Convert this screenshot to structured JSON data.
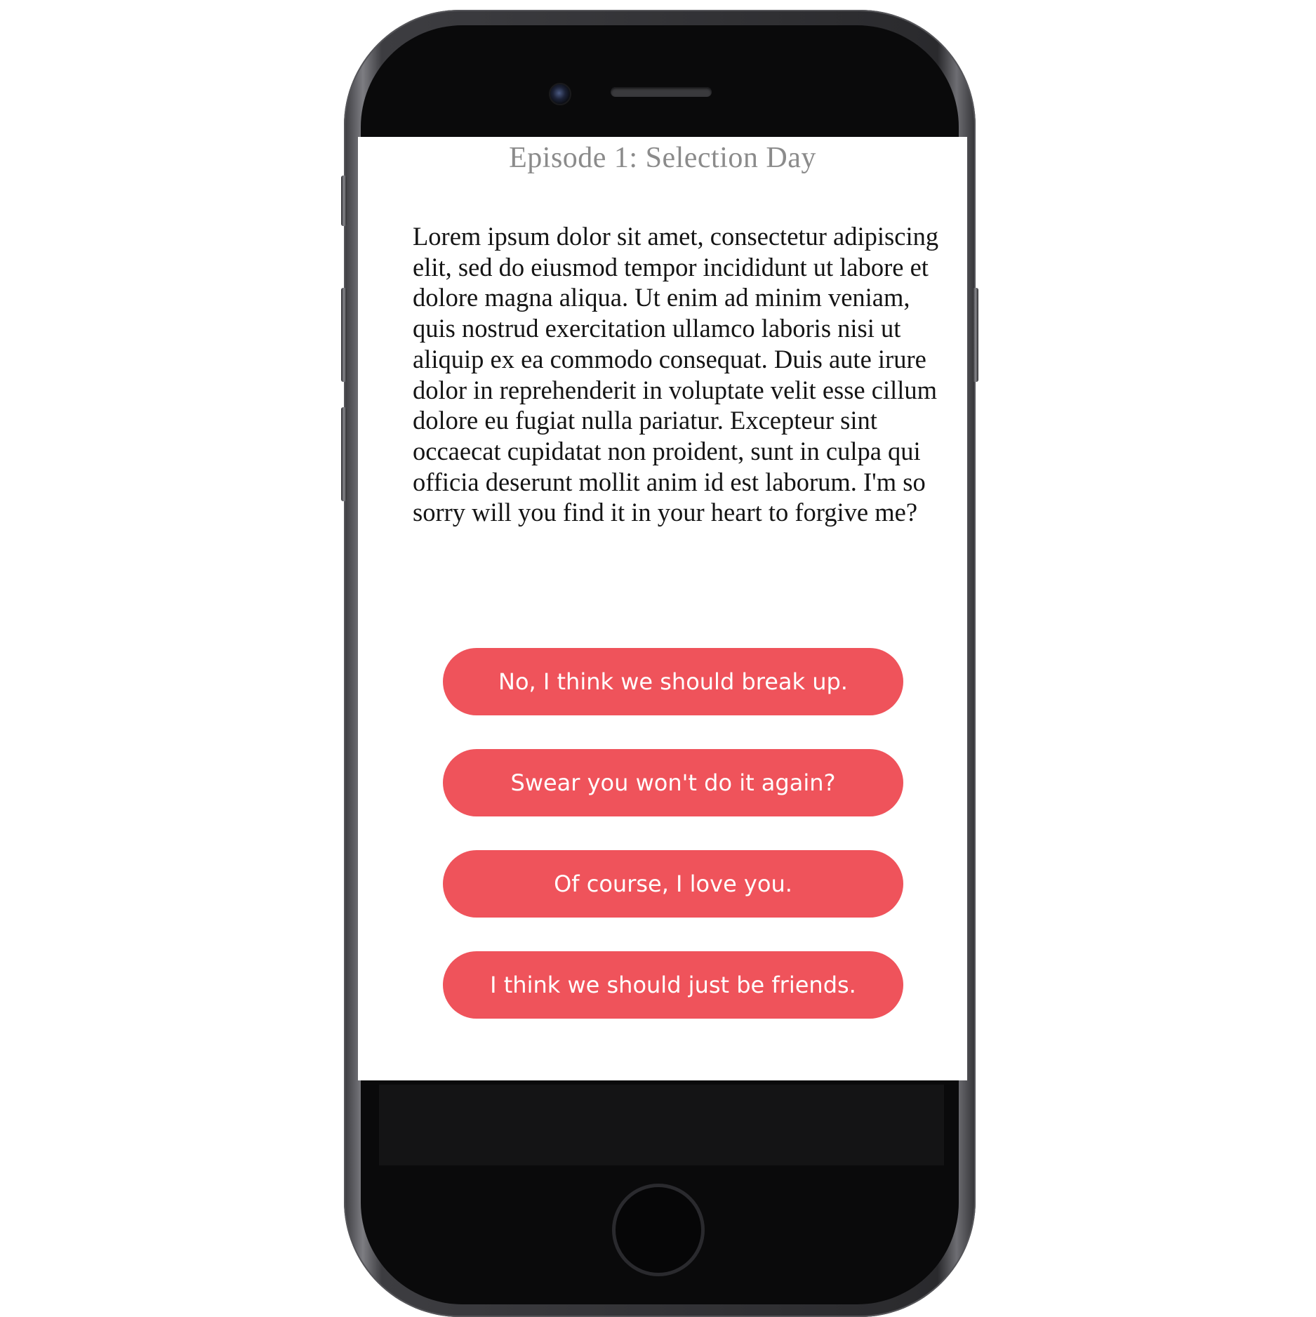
{
  "episode": {
    "title": "Episode 1: Selection Day"
  },
  "story": {
    "text": "Lorem ipsum dolor sit amet, consectetur adipiscing elit, sed do eiusmod tempor incididunt ut labore et dolore magna aliqua. Ut enim ad minim veniam, quis nostrud exercitation ullamco laboris nisi ut aliquip ex ea commodo consequat. Duis aute irure dolor in reprehenderit in voluptate velit esse cillum dolore eu fugiat nulla pariatur. Excepteur sint occaecat cupidatat non proident, sunt in culpa qui officia deserunt mollit anim id est laborum. I'm so sorry will you find it in your heart to forgive me?"
  },
  "choices": [
    {
      "label": "No, I think we should break up."
    },
    {
      "label": "Swear you won't do it again?"
    },
    {
      "label": "Of course, I love you."
    },
    {
      "label": "I think we should just be friends."
    }
  ],
  "colors": {
    "choice_button": "#ef535b",
    "title_text": "#8b8b8b",
    "phone_body": "#0a0a0b"
  }
}
